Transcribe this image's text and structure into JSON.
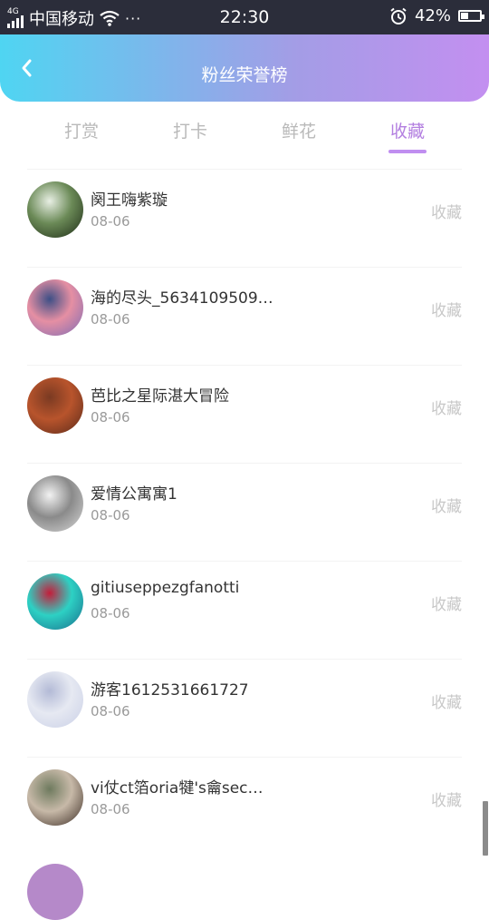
{
  "status_bar": {
    "network": "4G",
    "carrier": "中国移动",
    "more": "···",
    "time": "22:30",
    "battery": "42%",
    "battery_level": 0.42
  },
  "header": {
    "title": "粉丝荣誉榜",
    "back_icon": "chevron-left-icon"
  },
  "tabs": [
    {
      "label": "打赏",
      "active": false
    },
    {
      "label": "打卡",
      "active": false
    },
    {
      "label": "鲜花",
      "active": false
    },
    {
      "label": "收藏",
      "active": true
    }
  ],
  "list": [
    {
      "name": "阕王嗨紫璇",
      "date": "08-06",
      "action": "收藏",
      "avatar_colors": [
        "#1c2a15",
        "#6b8a57",
        "#e8efe4"
      ]
    },
    {
      "name": "海的尽头_5634109509…",
      "date": "08-06",
      "action": "收藏",
      "avatar_colors": [
        "#7d6bb5",
        "#e58fa3",
        "#3d4f86"
      ]
    },
    {
      "name": "芭比之星际湛大冒险",
      "date": "08-06",
      "action": "收藏",
      "avatar_colors": [
        "#5a2a1a",
        "#b8542c",
        "#7a3a22"
      ]
    },
    {
      "name": "爱情公寓寓1",
      "date": "08-06",
      "action": "收藏",
      "avatar_colors": [
        "#d8d8d8",
        "#8a8a8a",
        "#f2f2f2"
      ]
    },
    {
      "name": "gitiuseppezgfanotti",
      "date": "08-06",
      "action": "收藏",
      "avatar_colors": [
        "#1a6d8c",
        "#2dd1c4",
        "#c41d3a"
      ]
    },
    {
      "name": "游客1612531661727",
      "date": "08-06",
      "action": "收藏",
      "avatar_colors": [
        "#c9cfe6",
        "#e6e9f2",
        "#b3bad6"
      ]
    },
    {
      "name": "vi仗ct箔oria犍's龠sec…",
      "date": "08-06",
      "action": "收藏",
      "avatar_colors": [
        "#3a2a22",
        "#c7b9a8",
        "#6e7a5e"
      ]
    }
  ]
}
